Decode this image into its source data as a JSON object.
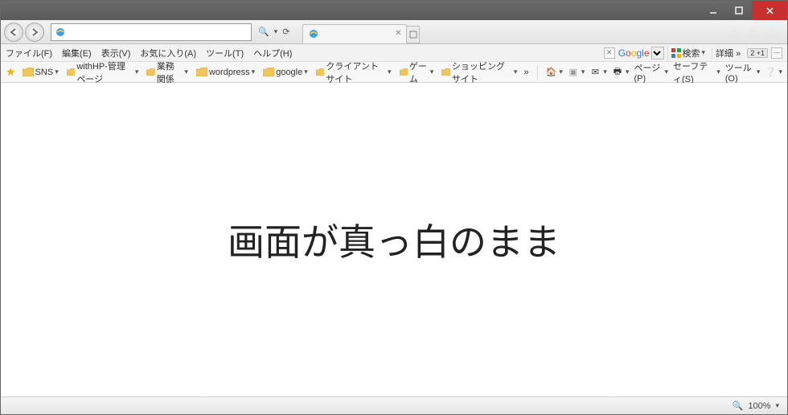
{
  "window": {
    "title": ""
  },
  "nav": {
    "address_value": "",
    "search_icon": "search-icon",
    "refresh_icon": "refresh-icon"
  },
  "tabs": [
    {
      "label": ""
    }
  ],
  "menu": {
    "items": [
      "ファイル(F)",
      "編集(E)",
      "表示(V)",
      "お気に入り(A)",
      "ツール(T)",
      "ヘルプ(H)"
    ],
    "search_provider": "Google",
    "search_button": "検索",
    "detail_button": "詳細 »",
    "badge": "2 +1"
  },
  "bookmarks": {
    "items": [
      "SNS",
      "withHP-管理ページ",
      "業務関係",
      "wordpress",
      "google",
      "クライアントサイト",
      "ゲーム",
      "ショッピングサイト"
    ],
    "overflow": "»"
  },
  "commandbar": {
    "items": [
      "ページ(P)",
      "セーフティ(S)",
      "ツール(O)"
    ]
  },
  "page": {
    "message": "画面が真っ白のまま"
  },
  "status": {
    "zoom": "100%"
  }
}
